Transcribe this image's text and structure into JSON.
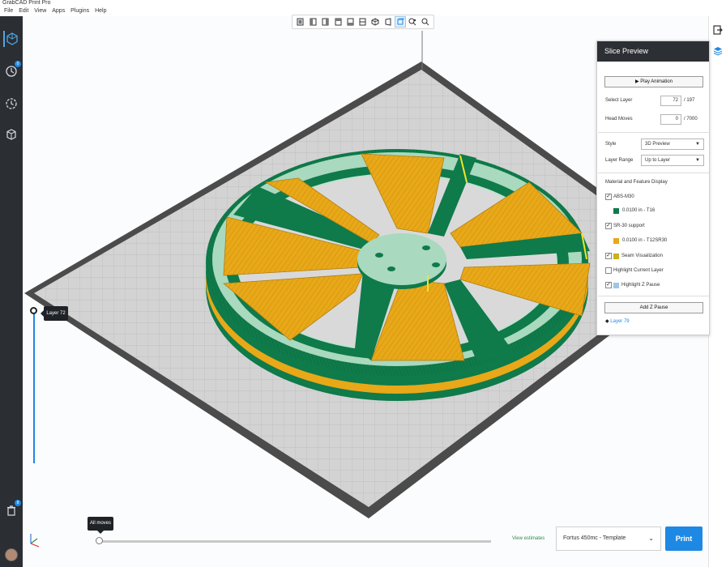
{
  "window": {
    "title": "GrabCAD Print Pro"
  },
  "menu": [
    "File",
    "Edit",
    "View",
    "Apps",
    "Plugins",
    "Help"
  ],
  "toolbar": {
    "icons": [
      "view-front-icon",
      "view-back-icon",
      "view-left-icon",
      "view-right-icon",
      "view-top-icon",
      "view-bottom-icon",
      "view-iso-icon",
      "perspective-icon",
      "orthographic-icon",
      "fit-view-icon",
      "zoom-icon"
    ]
  },
  "sidebar": {
    "items": [
      {
        "name": "models-icon",
        "active": true
      },
      {
        "name": "print-queue-icon",
        "badge": "0"
      },
      {
        "name": "history-icon"
      },
      {
        "name": "materials-icon"
      }
    ],
    "bottom_badge": "8"
  },
  "panel": {
    "title": "Slice Preview",
    "play_label": "Play Animation",
    "select_layer_label": "Select Layer",
    "select_layer_value": "72",
    "select_layer_max": "/ 197",
    "head_moves_label": "Head Moves",
    "head_moves_value": "0",
    "head_moves_max": "/ 7000",
    "style_label": "Style",
    "style_value": "3D Preview",
    "range_label": "Layer Range",
    "range_value": "Up to Layer",
    "section_title": "Material and Feature Display",
    "materials": [
      {
        "label": "ABS-M30",
        "checked": true,
        "sub": "0.0100 in - T16",
        "color": "#0f7a4a"
      },
      {
        "label": "SR-30 support",
        "checked": true,
        "sub": "0.0100 in - T12SR30",
        "color": "#e8a818"
      }
    ],
    "features": [
      {
        "label": "Seam Visualization",
        "checked": true,
        "color": "#c9b21c"
      },
      {
        "label": "Highlight Current Layer",
        "checked": false
      },
      {
        "label": "Highlight Z Pause",
        "checked": true,
        "color": "#9fc5e8"
      }
    ],
    "add_pause_label": "Add Z Pause",
    "pause_item": "Layer 79"
  },
  "layer_slider": {
    "label": "Layer 72",
    "value": 72,
    "max": 197
  },
  "moves_slider": {
    "label": "All moves"
  },
  "footer": {
    "view_estimates": "View estimates",
    "printer": "Fortus 450mc - Template",
    "print_label": "Print"
  },
  "colors": {
    "accent": "#1e88e5",
    "model": "#0f7a4a",
    "support": "#e8a818",
    "dark": "#2b2e33"
  }
}
